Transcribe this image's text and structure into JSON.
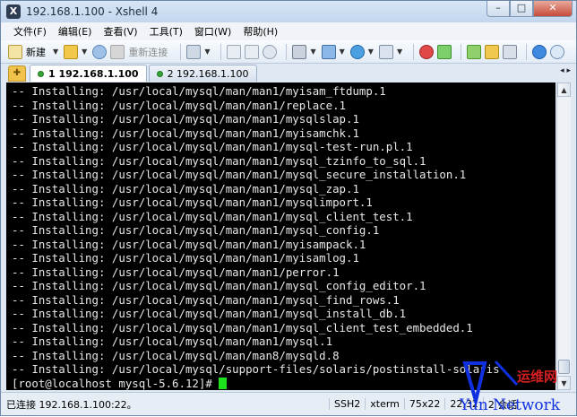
{
  "window": {
    "title": "192.168.1.100 - Xshell 4",
    "controls": {
      "minimize": "–",
      "maximize": "□",
      "close": "✕"
    }
  },
  "menubar": {
    "items": [
      "文件(F)",
      "编辑(E)",
      "查看(V)",
      "工具(T)",
      "窗口(W)",
      "帮助(H)"
    ]
  },
  "toolbar": {
    "new_label": "新建",
    "reconnect_label": "重新连接"
  },
  "tabs": {
    "items": [
      {
        "label": "1 192.168.1.100",
        "active": true
      },
      {
        "label": "2 192.168.1.100",
        "active": false
      }
    ],
    "nav": "◂ ▸"
  },
  "terminal": {
    "lines": [
      "-- Installing: /usr/local/mysql/man/man1/myisam_ftdump.1",
      "-- Installing: /usr/local/mysql/man/man1/replace.1",
      "-- Installing: /usr/local/mysql/man/man1/mysqlslap.1",
      "-- Installing: /usr/local/mysql/man/man1/myisamchk.1",
      "-- Installing: /usr/local/mysql/man/man1/mysql-test-run.pl.1",
      "-- Installing: /usr/local/mysql/man/man1/mysql_tzinfo_to_sql.1",
      "-- Installing: /usr/local/mysql/man/man1/mysql_secure_installation.1",
      "-- Installing: /usr/local/mysql/man/man1/mysql_zap.1",
      "-- Installing: /usr/local/mysql/man/man1/mysqlimport.1",
      "-- Installing: /usr/local/mysql/man/man1/mysql_client_test.1",
      "-- Installing: /usr/local/mysql/man/man1/mysql_config.1",
      "-- Installing: /usr/local/mysql/man/man1/myisampack.1",
      "-- Installing: /usr/local/mysql/man/man1/myisamlog.1",
      "-- Installing: /usr/local/mysql/man/man1/perror.1",
      "-- Installing: /usr/local/mysql/man/man1/mysql_config_editor.1",
      "-- Installing: /usr/local/mysql/man/man1/mysql_find_rows.1",
      "-- Installing: /usr/local/mysql/man/man1/mysql_install_db.1",
      "-- Installing: /usr/local/mysql/man/man1/mysql_client_test_embedded.1",
      "-- Installing: /usr/local/mysql/man/man1/mysql.1",
      "-- Installing: /usr/local/mysql/man/man8/mysqld.8",
      "-- Installing: /usr/local/mysql/support-files/solaris/postinstall-solaris"
    ],
    "prompt": "[root@localhost mysql-5.6.12]# "
  },
  "statusbar": {
    "connection": "已连接 192.168.1.100:22。",
    "protocol": "SSH2",
    "terminal_type": "xterm",
    "size": "75x22",
    "cursor_pos": "22,32",
    "sessions": "2 会话"
  },
  "watermark": {
    "text": "Yun Network",
    "cn_text": "运维网"
  },
  "colors": {
    "terminal_bg": "#000000",
    "terminal_fg": "#e8e8e8",
    "cursor": "#1fe21f",
    "watermark": "#1030e0"
  }
}
